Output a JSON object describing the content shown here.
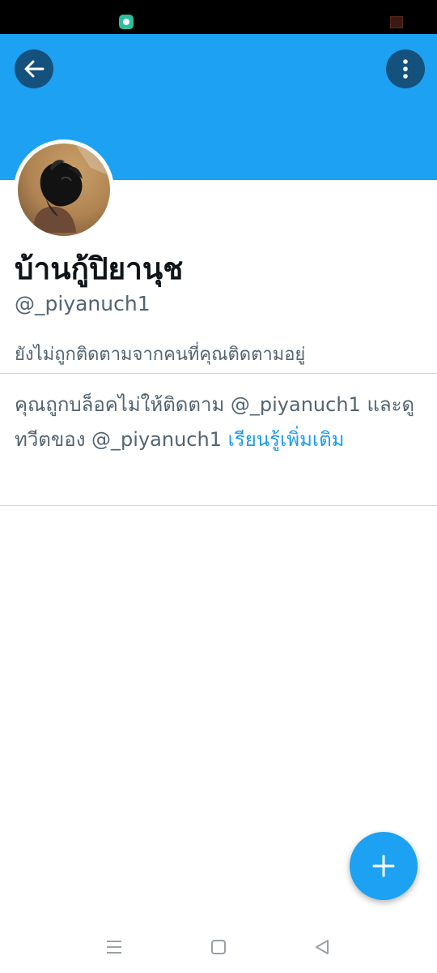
{
  "status_bar": {
    "app_icon": "messaging-app-icon",
    "battery_icon": "battery-icon"
  },
  "header": {
    "back_icon": "arrow-left-icon",
    "more_icon": "more-vertical-icon",
    "banner_color": "#1da1f2"
  },
  "profile": {
    "avatar_description_icon": "avatar-photo",
    "display_name": "บ้านกู้ปิยานุช",
    "handle": "@_piyanuch1",
    "follow_status": "ยังไม่ถูกติดตามจากคนที่คุณติดตามอยู่"
  },
  "blocked_notice": {
    "text": "คุณถูกบล็อคไม่ให้ติดตาม @_piyanuch1 และดูทวีตของ @_piyanuch1 ",
    "learn_more": "เรียนรู้เพิ่มเติม",
    "link_color": "#1d9bf0"
  },
  "fab": {
    "icon": "plus-icon"
  },
  "system_nav": {
    "menu_icon": "menu-icon",
    "home_icon": "home-square-icon",
    "back_icon": "back-triangle-icon"
  }
}
